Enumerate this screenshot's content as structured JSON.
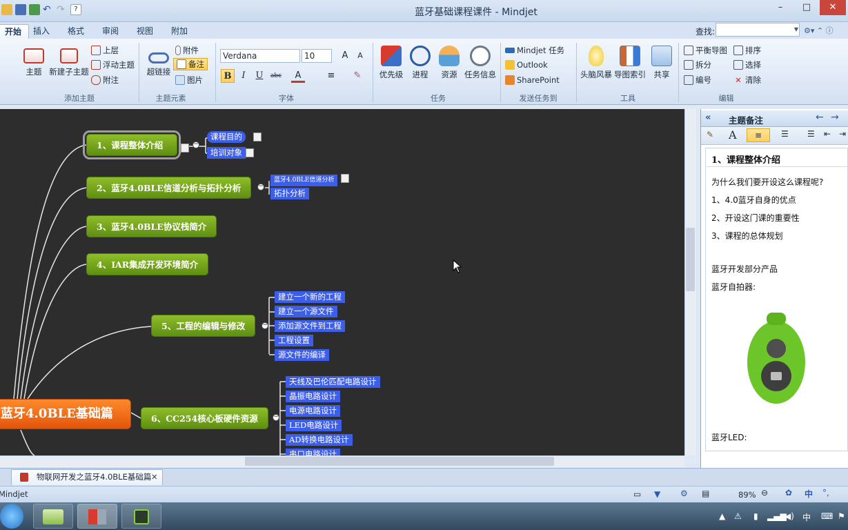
{
  "window": {
    "title": "蓝牙基础课程课件 - Mindjet"
  },
  "tabs": [
    "开始",
    "插入",
    "格式",
    "审阅",
    "视图",
    "附加"
  ],
  "find": {
    "label": "查找:"
  },
  "ribbon": {
    "add_topic": {
      "topic": "主题",
      "new_subtopic": "新建子主题",
      "above": "上层",
      "floating": "浮动主题",
      "callout": "附注",
      "group": "添加主题"
    },
    "topic_elements": {
      "hyperlink": "超链接",
      "attachment": "附件",
      "notes": "备注",
      "image": "图片",
      "group": "主题元素"
    },
    "font": {
      "family": "Verdana",
      "size": "10",
      "bold": "B",
      "italic": "I",
      "underline": "U",
      "strike": "abc",
      "group": "字体"
    },
    "task": {
      "priority": "优先级",
      "progress": "进程",
      "resource": "资源",
      "task_info": "任务信息",
      "group": "任务"
    },
    "send_task": {
      "mindjet_task": "Mindjet 任务",
      "outlook": "Outlook",
      "sharepoint": "SharePoint",
      "group": "发送任务到"
    },
    "tools": {
      "brainstorm": "头脑风暴",
      "map_index": "导图索引",
      "share": "共享",
      "group": "工具"
    },
    "edit": {
      "balance": "平衡导图",
      "split": "拆分",
      "numbering": "编号",
      "sort": "排序",
      "select": "选择",
      "clear": "清除",
      "group": "编辑"
    }
  },
  "map": {
    "central": "蓝牙4.0BLE基础篇",
    "topics": [
      {
        "label": "1、课程整体介绍",
        "subs": [
          "课程目的",
          "培训对象"
        ]
      },
      {
        "label": "2、蓝牙4.0BLE信道分析与拓扑分析",
        "subs": [
          "蓝牙4.0BLE信道分析",
          "拓扑分析"
        ]
      },
      {
        "label": "3、蓝牙4.0BLE协议栈简介",
        "subs": []
      },
      {
        "label": "4、IAR集成开发环境简介",
        "subs": []
      },
      {
        "label": "5、工程的编辑与修改",
        "subs": [
          "建立一个新的工程",
          "建立一个源文件",
          "添加源文件到工程",
          "工程设置",
          "源文件的编译"
        ]
      },
      {
        "label": "6、CC254核心板硬件资源",
        "subs": [
          "天线及巴伦匹配电路设计",
          "晶振电路设计",
          "电源电路设计",
          "LED电路设计",
          "AD转换电路设计",
          "串口电路设计"
        ]
      }
    ]
  },
  "notes_panel": {
    "title": "主题备注",
    "heading": "1、课程整体介绍",
    "lines": [
      "为什么我们要开设这么课程呢?",
      "1、4.0蓝牙自身的优点",
      "2、开设这门课的重要性",
      "3、课程的总体规划",
      "",
      "蓝牙开发部分产品",
      "蓝牙自拍器:",
      "蓝牙LED:"
    ]
  },
  "doc_tab": {
    "label": "物联网开发之蓝牙4.0BLE基础篇"
  },
  "status": {
    "app": "Mindjet",
    "zoom": "89%"
  },
  "tray": {
    "ime": "中",
    "ime2": "中"
  },
  "colors": {
    "topic_green": "#6f9c18",
    "subtopic_blue": "#3d5ee8",
    "central_orange": "#f26b15",
    "canvas": "#2d2d2d"
  }
}
